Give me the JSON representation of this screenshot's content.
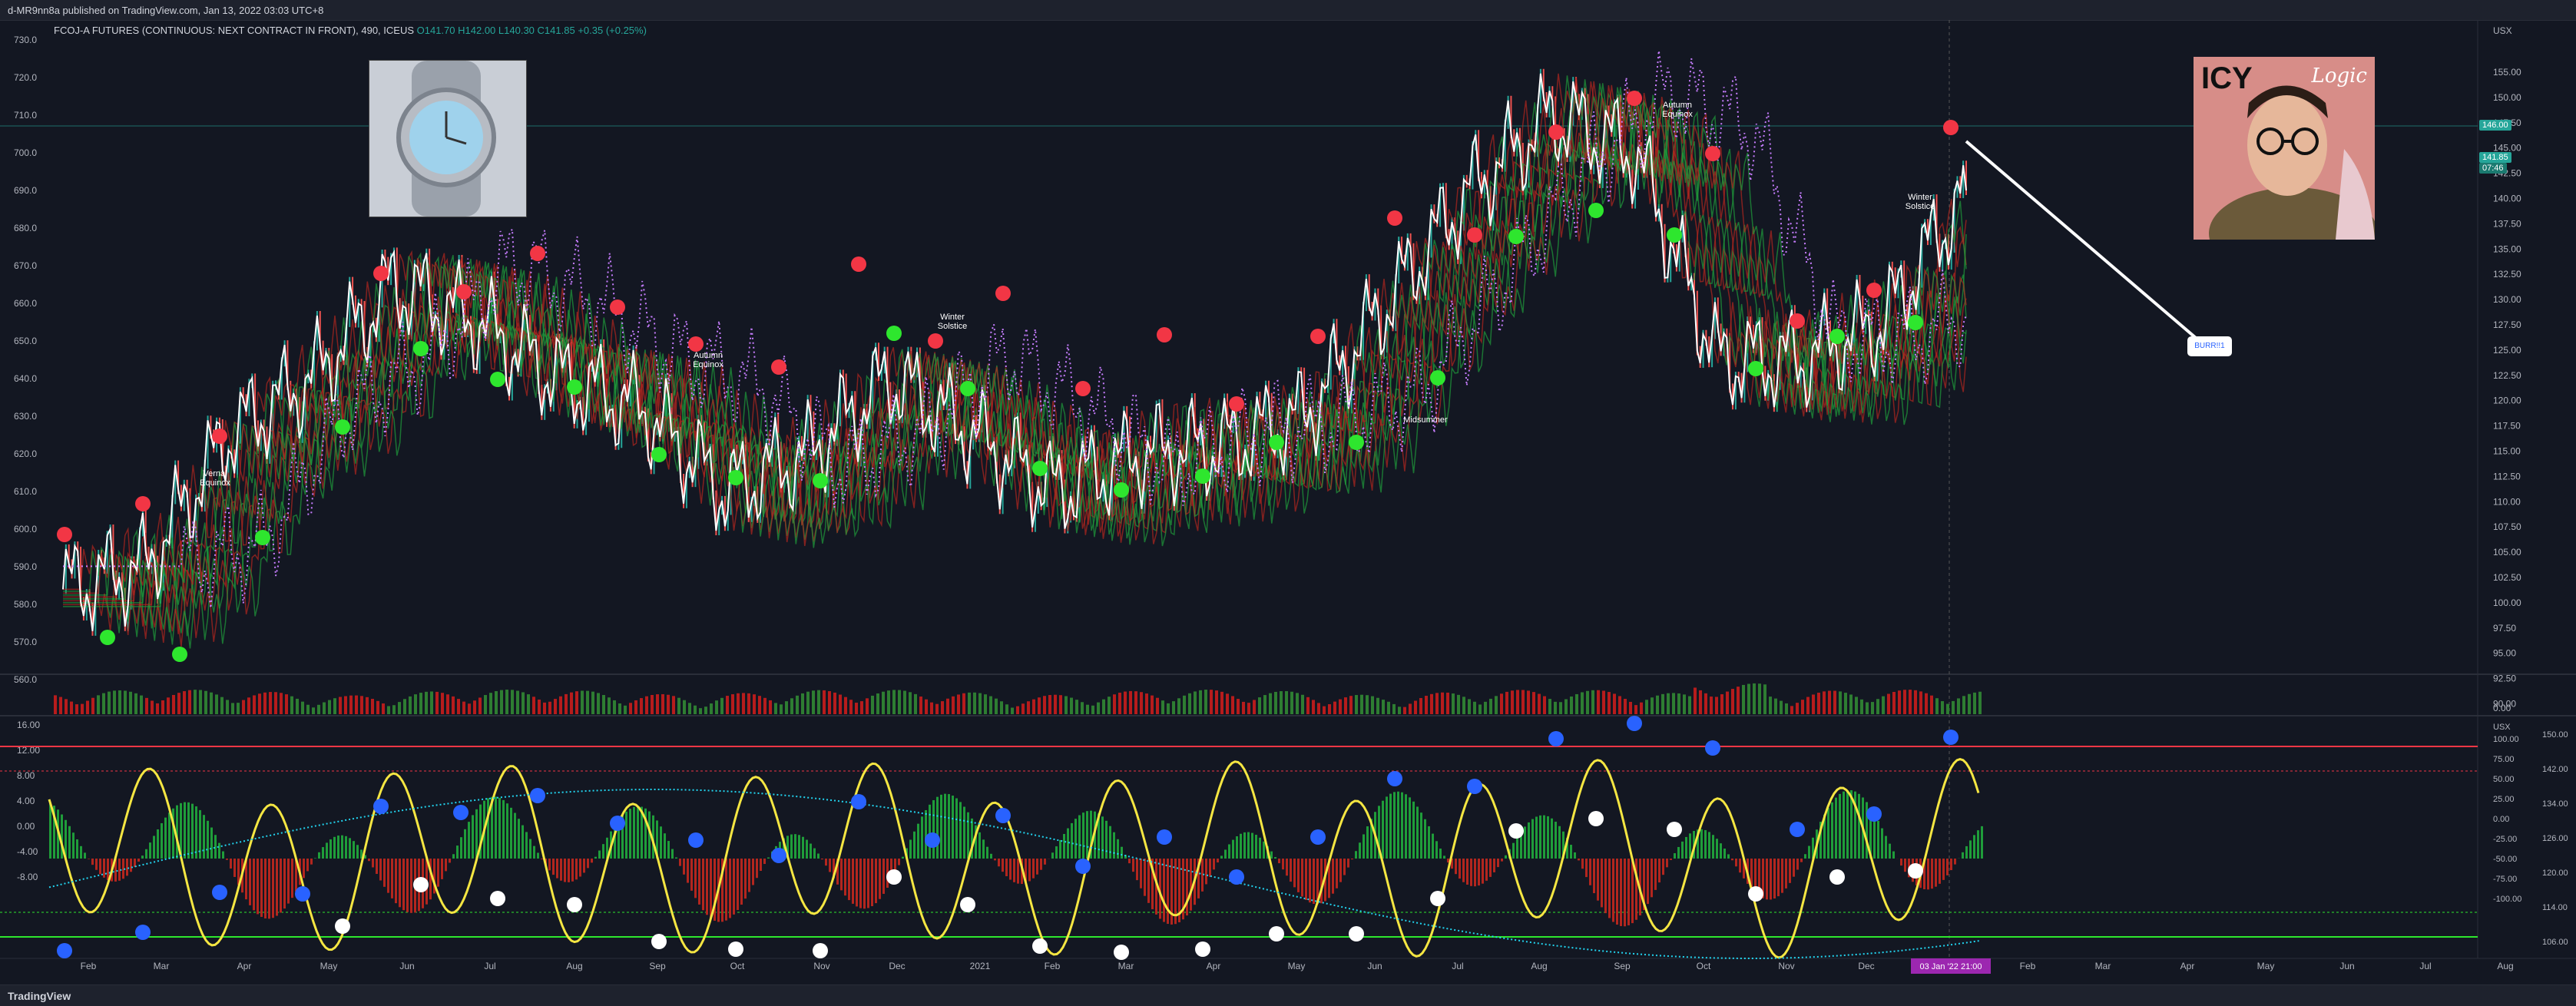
{
  "header": {
    "publish_line": "d-MR9nn8a published on TradingView.com, Jan 13, 2022 03:03 UTC+8"
  },
  "legend": {
    "symbol": "FCOJ-A FUTURES (CONTINUOUS: NEXT CONTRACT IN FRONT), 490, ICEUS",
    "open": "O141.70",
    "high": "H142.00",
    "low": "L140.30",
    "close": "C141.85",
    "change": "+0.35 (+0.25%)"
  },
  "main_left_axis": [
    "730.0",
    "720.0",
    "710.0",
    "700.0",
    "690.0",
    "680.0",
    "670.0",
    "660.0",
    "650.0",
    "640.0",
    "630.0",
    "620.0",
    "610.0",
    "600.0",
    "590.0",
    "580.0",
    "570.0",
    "560.0"
  ],
  "main_right_axis": [
    "USX",
    "155.00",
    "150.00",
    "147.50",
    "145.00",
    "142.50",
    "140.00",
    "137.50",
    "135.00",
    "132.50",
    "130.00",
    "127.50",
    "125.00",
    "122.50",
    "120.00",
    "117.50",
    "115.00",
    "112.50",
    "110.00",
    "107.50",
    "105.00",
    "102.50",
    "100.00",
    "97.50",
    "95.00",
    "92.50",
    "90.00",
    "0.00"
  ],
  "price_tags": {
    "line": "146.00",
    "last": "141.85",
    "timer": "07:46"
  },
  "osc_left_axis": [
    "16.00",
    "12.00",
    "8.00",
    "4.00",
    "0.00",
    "-4.00",
    "-8.00"
  ],
  "osc_right_axis_inner": [
    "USX",
    "100.00",
    "75.00",
    "50.00",
    "25.00",
    "0.00",
    "-25.00",
    "-50.00",
    "-75.00",
    "-100.00"
  ],
  "osc_right_axis_outer": [
    "150.00",
    "142.00",
    "134.00",
    "126.00",
    "120.00",
    "114.00",
    "106.00"
  ],
  "time_axis": [
    "Feb",
    "Mar",
    "Apr",
    "May",
    "Jun",
    "Jul",
    "Aug",
    "Sep",
    "Oct",
    "Nov",
    "Dec",
    "2021",
    "Feb",
    "Mar",
    "Apr",
    "May",
    "Jun",
    "Jul",
    "Aug",
    "Sep",
    "Oct",
    "Nov",
    "Dec",
    "Feb",
    "Mar",
    "Apr",
    "May",
    "Jun",
    "Jul",
    "Aug"
  ],
  "time_cursor": "03 Jan '22  21:00",
  "annotations": {
    "vernal": "Vernal Equinox",
    "autumn1": "Autumn Equinox",
    "winter1": "Winter Solstice",
    "midsummer": "Midsummer",
    "autumn2": "Autumn Equinox",
    "winter2": "Winter Solstice",
    "callout": "BURR!!1"
  },
  "image_overlays": {
    "album_title": "ICY",
    "album_script": "Logic"
  },
  "footer": {
    "brand": "TradingView"
  },
  "colors": {
    "background": "#131722",
    "bull": "#26a69a",
    "bear": "#ef5350",
    "signal_red": "#f23645",
    "signal_green": "#2ee62e",
    "signal_blue": "#2962ff",
    "osc_line": "#f5e642",
    "ma_purple": "#c77dff",
    "ma_cyan": "#22d3ee"
  },
  "chart_data": {
    "type": "line",
    "title": "FCOJ-A FUTURES (CONTINUOUS: NEXT CONTRACT IN FRONT), 490, ICEUS",
    "x": [
      "Feb",
      "Mar",
      "Apr",
      "May",
      "Jun",
      "Jul",
      "Aug",
      "Sep",
      "Oct",
      "Nov",
      "Dec",
      "2021",
      "Feb",
      "Mar",
      "Apr",
      "May",
      "Jun",
      "Jul",
      "Aug",
      "Sep",
      "Oct",
      "Nov",
      "Dec",
      "Jan"
    ],
    "series": [
      {
        "name": "",
        "values": [
          584,
          590,
          625,
          640,
          665,
          655,
          640,
          632,
          610,
          620,
          640,
          625,
          610,
          620,
          622,
          630,
          660,
          690,
          710,
          700,
          645,
          645,
          655,
          690
        ]
      }
    ],
    "ylim": [
      555,
      735
    ],
    "oscillator_ylim": [
      -10,
      16
    ]
  }
}
